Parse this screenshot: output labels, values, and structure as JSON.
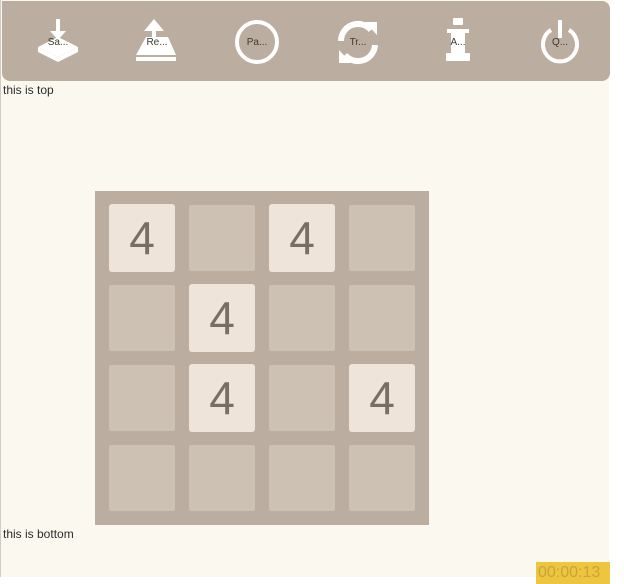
{
  "toolbar": {
    "buttons": [
      {
        "label": "Sa...",
        "icon": "save-icon"
      },
      {
        "label": "Re...",
        "icon": "restore-icon"
      },
      {
        "label": "Pa...",
        "icon": "pause-icon"
      },
      {
        "label": "Tr...",
        "icon": "refresh-icon"
      },
      {
        "label": "A...",
        "icon": "info-icon"
      },
      {
        "label": "Q...",
        "icon": "power-icon"
      }
    ]
  },
  "markers": {
    "top": "this is top",
    "bottom": "this is bottom"
  },
  "board": {
    "size": 4,
    "cells": [
      [
        "4",
        "",
        "4",
        ""
      ],
      [
        "",
        "4",
        "",
        ""
      ],
      [
        "",
        "4",
        "",
        "4"
      ],
      [
        "",
        "",
        "",
        ""
      ]
    ]
  },
  "timer": "00:00:13",
  "colors": {
    "toolbar": "#bbada0",
    "board": "#bbada0",
    "empty_cell": "#cdc1b4",
    "tile_4": "#eee4da",
    "tile_text": "#776e65",
    "timer_bg": "#edc53f",
    "page_bg": "#fbf8ef"
  }
}
